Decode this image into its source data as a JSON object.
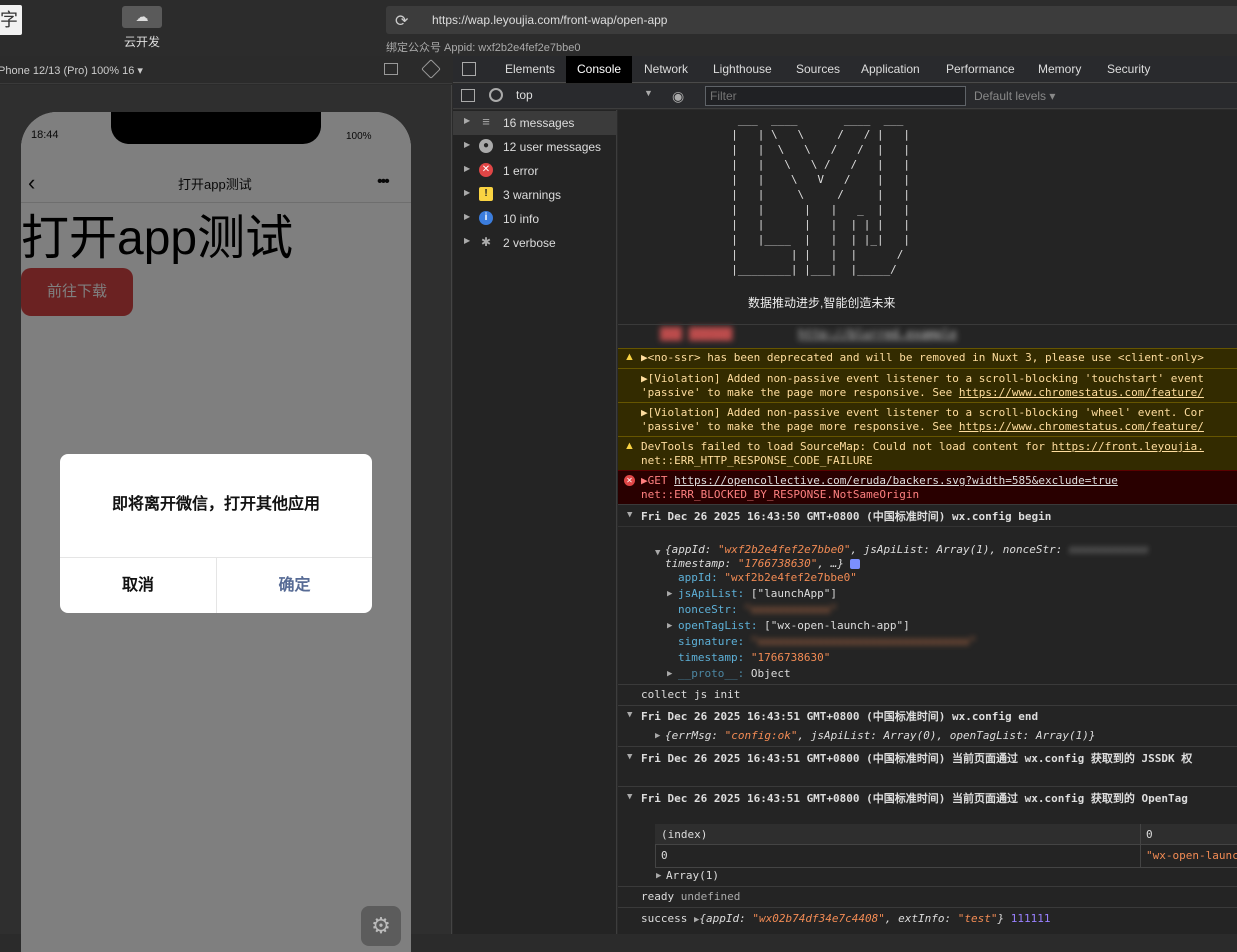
{
  "topbar": {
    "logo_glyph": "字",
    "cloud_icon": "cloud-icon",
    "cloud_glyph": "☁",
    "cloud_label": "云开发",
    "url": "https://wap.leyoujia.com/front-wap/open-app",
    "appid_line": "绑定公众号 Appid: wxf2b2e4fef2e7bbe0"
  },
  "device_bar": {
    "label": "Phone 12/13 (Pro) 100% 16 ▾"
  },
  "phone": {
    "time": "18:44",
    "battery": "100%",
    "back_glyph": "‹",
    "title": "打开app测试",
    "more_glyph": "•••",
    "heading": "打开app测试",
    "download_button": "前往下载",
    "dialog": {
      "title": "即将离开微信，打开其他应用",
      "cancel": "取消",
      "ok": "确定"
    },
    "gear_glyph": "⚙"
  },
  "devtools": {
    "tabs": [
      "Elements",
      "Console",
      "Network",
      "Lighthouse",
      "Sources",
      "Application",
      "Performance",
      "Memory",
      "Security"
    ],
    "active_tab": "Console",
    "context": "top",
    "filter_placeholder": "Filter",
    "levels": "Default levels ▾",
    "sidebar": [
      {
        "label": "16 messages",
        "icon": "list-icon",
        "glyph": "≡",
        "color": "#555555"
      },
      {
        "label": "12 user messages",
        "icon": "user-icon",
        "glyph": "●",
        "color": "#777777"
      },
      {
        "label": "1 error",
        "icon": "error-icon",
        "glyph": "✕",
        "color": "#e04646"
      },
      {
        "label": "3 warnings",
        "icon": "warning-icon",
        "glyph": "!",
        "color": "#f9d342"
      },
      {
        "label": "10 info",
        "icon": "info-icon",
        "glyph": "i",
        "color": "#3b7ddd"
      },
      {
        "label": "2 verbose",
        "icon": "bug-icon",
        "glyph": "✱",
        "color": "#777777"
      }
    ]
  },
  "console": {
    "ascii_art": "   ___  ____       ____  ___\n  |   | \\   \\     /   / |   |\n  |   |  \\   \\   /   /  |   |\n  |   |   \\   \\ /   /   |   |\n  |   |    \\   V   /    |   |\n  |   |     \\     /     |   |\n  |   |      |   |   _  |   |\n  |   |      |   |  | | |   |\n  |   |____  |   |  | |_|   |\n  |        | |   |  |      /\n  |________| |___|  |_____/",
    "slogan": "数据推动进步,智能创造未来",
    "blurred_prefix": "▓▓▓ ▓▓▓▓▓▓",
    "blurred_link": "http://blurred.example",
    "warn1": "▶<no-ssr> has been deprecated and will be removed in Nuxt 3, please use <client-only>",
    "warn2a": "▶[Violation] Added non-passive event listener to a scroll-blocking 'touchstart' event",
    "warn2b_pre": "'passive' to make the page more responsive. See ",
    "warn2b_link": "https://www.chromestatus.com/feature/",
    "warn3a": "▶[Violation] Added non-passive event listener to a scroll-blocking 'wheel' event. Cor",
    "warn3b_pre": "'passive' to make the page more responsive. See ",
    "warn3b_link": "https://www.chromestatus.com/feature/",
    "warn4a_pre": "DevTools failed to load SourceMap: Could not load content for ",
    "warn4a_link": "https://front.leyoujia.",
    "warn4b": "net::ERR_HTTP_RESPONSE_CODE_FAILURE",
    "err1_pre": "▶GET ",
    "err1_link": "https://opencollective.com/eruda/backers.svg?width=585&exclude=true",
    "err1b": "net::ERR_BLOCKED_BY_RESPONSE.NotSameOrigin",
    "log1": "Fri Dec 26 2025 16:43:50 GMT+0800 (中国标准时间) wx.config begin",
    "obj1_open": "{appId: ",
    "obj1_appid": "\"wxf2b2e4fef2e7bbe0\"",
    "obj1_mid": ", jsApiList: Array(1), nonceStr: ",
    "obj1_ts_label": "timestamp: ",
    "obj1_ts": "\"1766738630\"",
    "obj1_ts_tail": ", …}",
    "prop_appId_k": "appId: ",
    "prop_appId_v": "\"wxf2b2e4fef2e7bbe0\"",
    "prop_js_k": "jsApiList: ",
    "prop_js_v": "[\"launchApp\"]",
    "prop_nonce_k": "nonceStr: ",
    "prop_nonce_v": "\"xxxxxxxxxxxx\"",
    "prop_tag_k": "openTagList: ",
    "prop_tag_v": "[\"wx-open-launch-app\"]",
    "prop_sig_k": "signature: ",
    "prop_sig_v": "\"xxxxxxxxxxxxxxxxxxxxxxxxxxxxxxxx\"",
    "prop_ts_k": "timestamp: ",
    "prop_ts_v": "\"1766738630\"",
    "prop_proto_k": "__proto__: ",
    "prop_proto_v": "Object",
    "log2": "collect js init",
    "log3": "Fri Dec 26 2025 16:43:51 GMT+0800 (中国标准时间) wx.config end",
    "obj3_a": "{errMsg: ",
    "obj3_b": "\"config:ok\"",
    "obj3_c": ", jsApiList: Array(0), openTagList: Array(1)}",
    "log4": "Fri Dec 26 2025 16:43:51 GMT+0800 (中国标准时间) 当前页面通过 wx.config 获取到的 JSSDK 权",
    "log5": "Fri Dec 26 2025 16:43:51 GMT+0800 (中国标准时间) 当前页面通过 wx.config 获取到的 OpenTag",
    "table_h1": "(index)",
    "table_h2": "0",
    "table_r1c1": "0",
    "table_r1c2": "\"wx-open-launch-app\"",
    "array_label": "Array(1)",
    "log6_k": "ready",
    "log6_v": "undefined",
    "log7_k": "success",
    "log7_a": "{appId: ",
    "log7_b": "\"wx02b74df34e7c4408\"",
    "log7_c": ", extInfo: ",
    "log7_d": "\"test\"",
    "log7_e": "}",
    "log7_num": "111111"
  }
}
